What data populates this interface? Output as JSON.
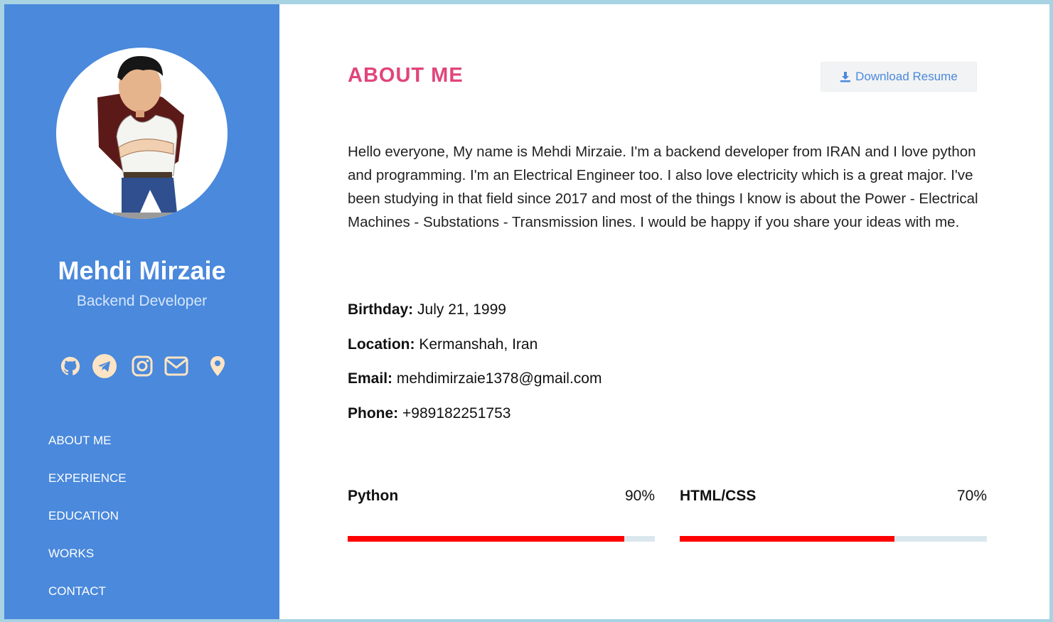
{
  "profile": {
    "name": "Mehdi Mirzaie",
    "role": "Backend Developer"
  },
  "social_icons": [
    "github-icon",
    "telegram-icon",
    "instagram-icon",
    "mail-icon",
    "location-pin-icon"
  ],
  "nav": {
    "items": [
      {
        "label": "ABOUT ME"
      },
      {
        "label": "EXPERIENCE"
      },
      {
        "label": "EDUCATION"
      },
      {
        "label": "WORKS"
      },
      {
        "label": "CONTACT"
      }
    ]
  },
  "main": {
    "title": "ABOUT ME",
    "download_label": "Download Resume",
    "about": "Hello everyone, My name is Mehdi Mirzaie. I'm a backend developer from IRAN and I love python and programming. I'm an Electrical Engineer too. I also love electricity which is a great major. I've been studying in that field since 2017 and most of the things I know is about the Power - Electrical Machines - Substations - Transmission lines. I would be happy if you share your ideas with me.",
    "info": [
      {
        "label": "Birthday:",
        "value": "July 21, 1999"
      },
      {
        "label": "Location:",
        "value": "Kermanshah, Iran"
      },
      {
        "label": "Email:",
        "value": "mehdimirzaie1378@gmail.com"
      },
      {
        "label": "Phone:",
        "value": "+989182251753"
      }
    ],
    "skills": [
      {
        "name": "Python",
        "percent_label": "90%",
        "level": 0.9
      },
      {
        "name": "HTML/CSS",
        "percent_label": "70%",
        "level": 0.7
      }
    ]
  },
  "colors": {
    "sidebar": "#4a89dc",
    "title": "#e0457b",
    "social_icons": "#fde4c4",
    "bar_fill": "#ff0000",
    "bar_track": "#dae8ee"
  }
}
